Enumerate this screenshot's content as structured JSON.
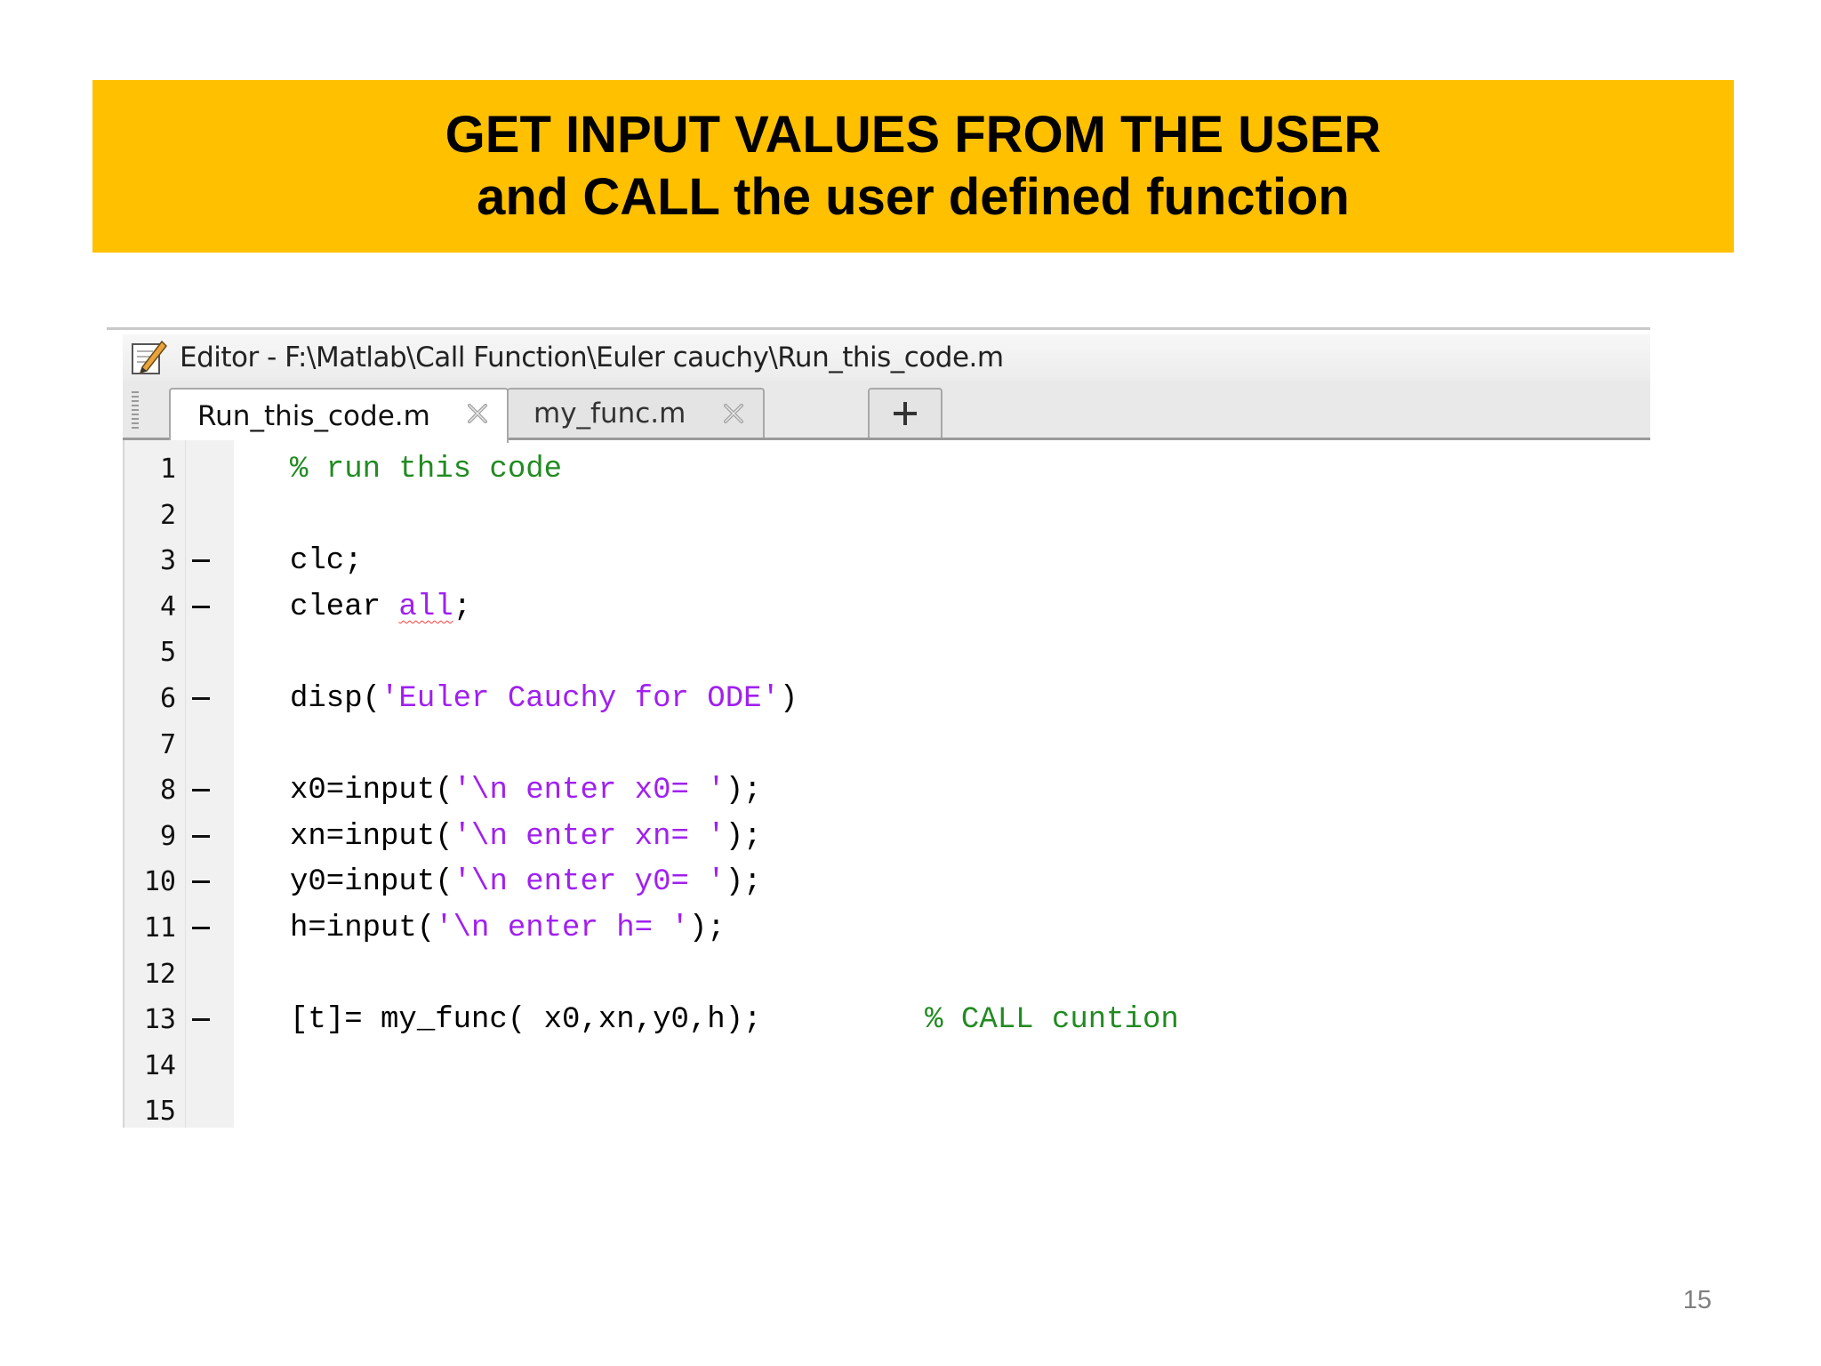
{
  "slide": {
    "title_line1": "GET INPUT VALUES FROM THE USER",
    "title_line2": "and CALL the user defined function",
    "page_number": "15",
    "banner_color": "#FFC000"
  },
  "editor": {
    "window_title": "Editor - F:\\Matlab\\Call Function\\Euler cauchy\\Run_this_code.m",
    "tabs": [
      {
        "label": "Run_this_code.m",
        "active": true
      },
      {
        "label": "my_func.m",
        "active": false
      }
    ],
    "add_tab_label": "+",
    "syntax_colors": {
      "comment": "#228B22",
      "string": "#A020F0",
      "keyword": "#000000"
    },
    "lines": [
      {
        "num": "1",
        "mark": false,
        "segments": [
          {
            "t": "% run this code",
            "k": "comment"
          }
        ]
      },
      {
        "num": "2",
        "mark": false,
        "segments": []
      },
      {
        "num": "3",
        "mark": true,
        "segments": [
          {
            "t": "clc;",
            "k": "code"
          }
        ]
      },
      {
        "num": "4",
        "mark": true,
        "segments": [
          {
            "t": "clear ",
            "k": "code"
          },
          {
            "t": "all",
            "k": "string-warn"
          },
          {
            "t": ";",
            "k": "code"
          }
        ]
      },
      {
        "num": "5",
        "mark": false,
        "segments": []
      },
      {
        "num": "6",
        "mark": true,
        "segments": [
          {
            "t": "disp(",
            "k": "code"
          },
          {
            "t": "'Euler Cauchy for ODE'",
            "k": "string"
          },
          {
            "t": ")",
            "k": "code"
          }
        ]
      },
      {
        "num": "7",
        "mark": false,
        "segments": []
      },
      {
        "num": "8",
        "mark": true,
        "segments": [
          {
            "t": "x0=input(",
            "k": "code"
          },
          {
            "t": "'\\n enter x0= '",
            "k": "string"
          },
          {
            "t": ");",
            "k": "code"
          }
        ]
      },
      {
        "num": "9",
        "mark": true,
        "segments": [
          {
            "t": "xn=input(",
            "k": "code"
          },
          {
            "t": "'\\n enter xn= '",
            "k": "string"
          },
          {
            "t": ");",
            "k": "code"
          }
        ]
      },
      {
        "num": "10",
        "mark": true,
        "segments": [
          {
            "t": "y0=input(",
            "k": "code"
          },
          {
            "t": "'\\n enter y0= '",
            "k": "string"
          },
          {
            "t": ");",
            "k": "code"
          }
        ]
      },
      {
        "num": "11",
        "mark": true,
        "segments": [
          {
            "t": "h=input(",
            "k": "code"
          },
          {
            "t": "'\\n enter h= '",
            "k": "string"
          },
          {
            "t": ");",
            "k": "code"
          }
        ]
      },
      {
        "num": "12",
        "mark": false,
        "segments": []
      },
      {
        "num": "13",
        "mark": true,
        "segments": [
          {
            "t": "[t]= my_func( x0,xn,y0,h);         ",
            "k": "code"
          },
          {
            "t": "% CALL cuntion",
            "k": "comment"
          }
        ]
      },
      {
        "num": "14",
        "mark": false,
        "segments": []
      },
      {
        "num": "15",
        "mark": false,
        "segments": []
      }
    ]
  },
  "icons": {
    "title_icon": "edit-pencil-icon",
    "tab_close_icon": "close-icon",
    "add_tab_icon": "plus-icon"
  }
}
